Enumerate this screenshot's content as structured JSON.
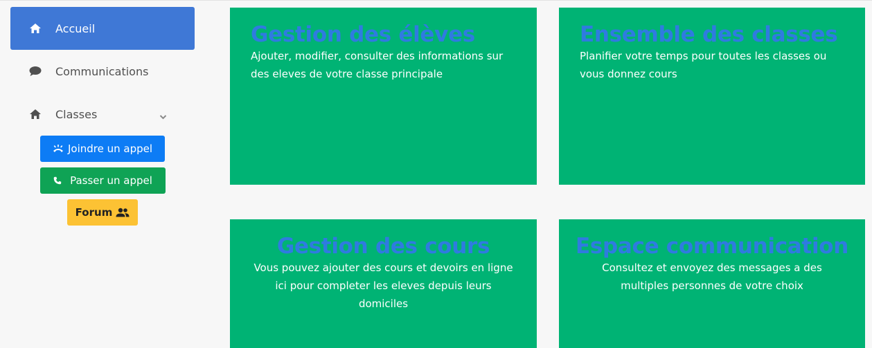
{
  "sidebar": {
    "items": [
      {
        "label": "Accueil",
        "icon": "home-icon",
        "active": true
      },
      {
        "label": "Communications",
        "icon": "comment-icon",
        "active": false
      },
      {
        "label": "Classes",
        "icon": "home-icon",
        "active": false
      }
    ],
    "buttons": {
      "join_call": {
        "label": "Joindre un appel",
        "icon": "join-call-icon",
        "color": "#0d7cf5"
      },
      "make_call": {
        "label": "Passer un appel",
        "icon": "phone-icon",
        "color": "#0fa355"
      },
      "forum": {
        "label": "Forum",
        "icon": "users-icon",
        "color": "#fcc234"
      }
    }
  },
  "cards": [
    {
      "title": "Gestion des élèves",
      "description": "Ajouter, modifier, consulter des informations sur des eleves de votre classe principale"
    },
    {
      "title": "Ensemble des classes",
      "description": "Planifier votre temps pour toutes les classes ou vous donnez cours"
    },
    {
      "title": "Gestion des cours",
      "description": "Vous pouvez ajouter des cours et devoirs en ligne ici pour completer les eleves depuis leurs domiciles"
    },
    {
      "title": "Espace communication",
      "description": "Consultez et envoyez des messages a des multiples personnes de votre choix"
    }
  ],
  "colors": {
    "card_background": "#00b374",
    "card_title": "#2f7be0",
    "active_nav": "#3f78d6"
  }
}
